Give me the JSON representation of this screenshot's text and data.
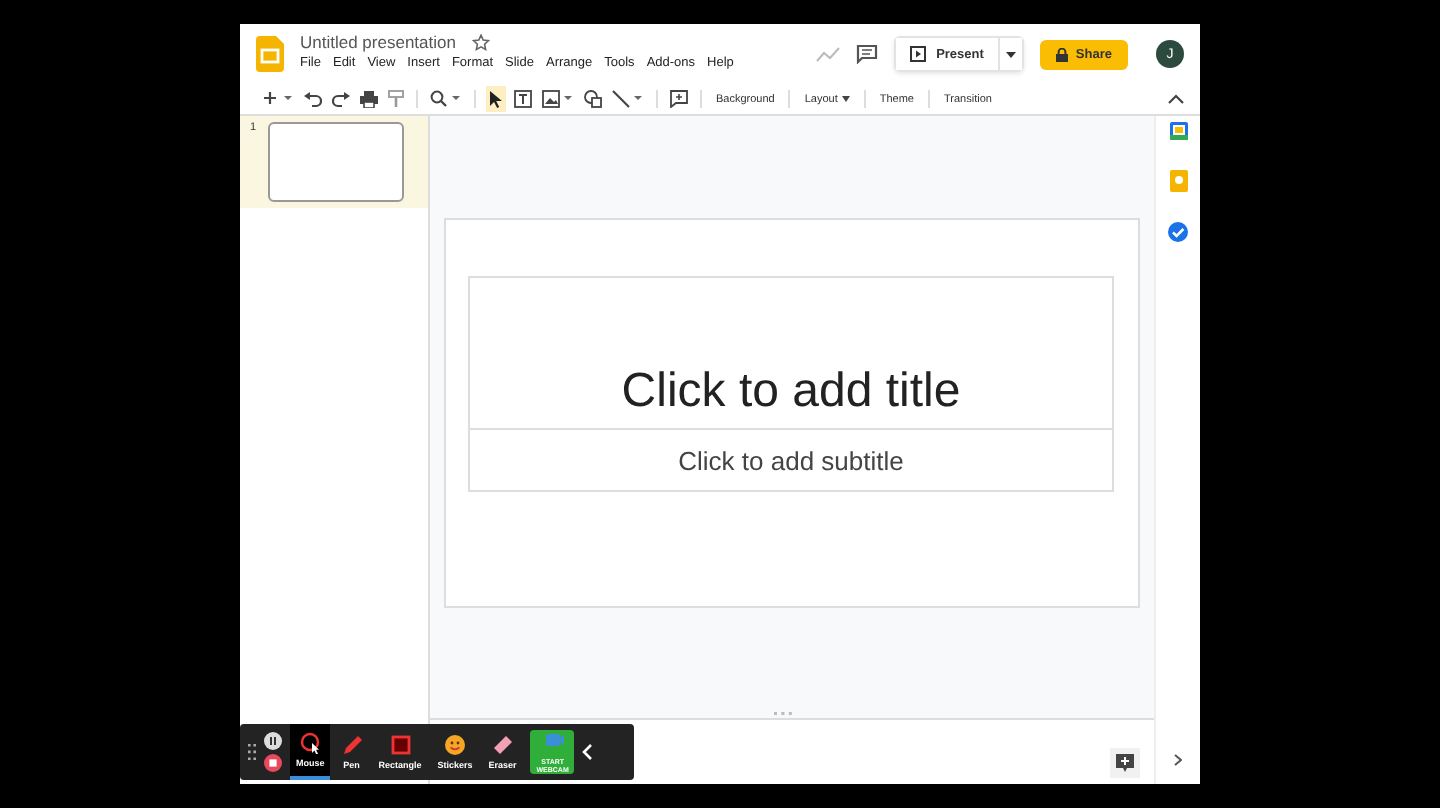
{
  "document": {
    "title": "Untitled presentation"
  },
  "menu": [
    "File",
    "Edit",
    "View",
    "Insert",
    "Format",
    "Slide",
    "Arrange",
    "Tools",
    "Add-ons",
    "Help"
  ],
  "header": {
    "present_label": "Present",
    "share_label": "Share",
    "avatar": "J"
  },
  "toolbar": {
    "tools": [
      {
        "kind": "new",
        "selected": false
      },
      {
        "kind": "undo",
        "selected": false
      },
      {
        "kind": "redo",
        "selected": false
      },
      {
        "kind": "print",
        "selected": false
      },
      {
        "kind": "paint",
        "selected": false
      },
      {
        "kind": "zoom",
        "selected": false
      },
      {
        "kind": "select",
        "selected": true
      },
      {
        "kind": "textbox",
        "selected": false
      },
      {
        "kind": "image",
        "selected": false
      },
      {
        "kind": "shape",
        "selected": false
      },
      {
        "kind": "line",
        "selected": false
      },
      {
        "kind": "comment",
        "selected": false
      }
    ],
    "buttons": [
      {
        "label": "Background",
        "dropdown": false
      },
      {
        "label": "Layout",
        "dropdown": true
      },
      {
        "label": "Theme",
        "dropdown": false
      },
      {
        "label": "Transition",
        "dropdown": false
      }
    ]
  },
  "slides": [
    {
      "number": "1",
      "selected": true
    }
  ],
  "slide": {
    "title_placeholder": "Click to add title",
    "subtitle_placeholder": "Click to add subtitle"
  },
  "recorder": {
    "tools": [
      {
        "label": "Mouse",
        "kind": "mouse",
        "selected": true
      },
      {
        "label": "Pen",
        "kind": "pen",
        "selected": false
      },
      {
        "label": "Rectangle",
        "kind": "rectangle",
        "selected": false
      },
      {
        "label": "Stickers",
        "kind": "stickers",
        "selected": false
      },
      {
        "label": "Eraser",
        "kind": "eraser",
        "selected": false
      },
      {
        "label": "START WEBCAM",
        "kind": "webcam",
        "selected": false
      }
    ]
  }
}
